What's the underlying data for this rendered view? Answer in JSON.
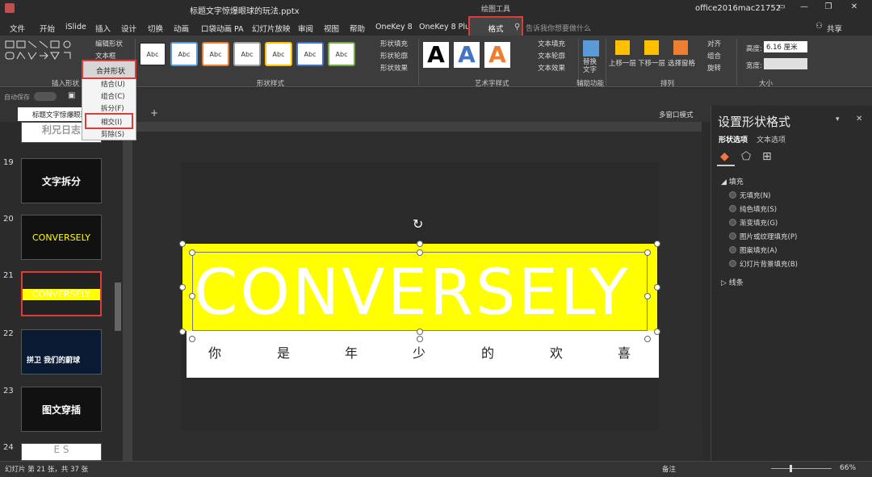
{
  "window": {
    "doc_title": "标题文字惊爆眼球的玩法.pptx",
    "user": "office2016mac21752",
    "drawing_tools_label": "绘图工具",
    "min": "—",
    "restore": "❐",
    "close": "✕"
  },
  "menu": {
    "tabs": [
      "文件",
      "开始",
      "iSlide",
      "插入",
      "设计",
      "切换",
      "动画",
      "口袋动画 PA",
      "幻灯片放映",
      "审阅",
      "视图",
      "帮助",
      "OneKey 8",
      "OneKey 8 Plus"
    ],
    "active_tab": "格式",
    "tellme": "告诉我你想要做什么",
    "share": "共享"
  },
  "ribbon": {
    "edit_shape": "编辑形状",
    "textbox": "文本框",
    "merge_shapes": "合并形状",
    "group_insert": "插入形状",
    "style_label": "Abc",
    "group_shape_styles": "形状样式",
    "shape_fill": "形状填充",
    "shape_outline": "形状轮廓",
    "shape_effect": "形状效果",
    "art_letter": "A",
    "text_fill": "文本填充",
    "text_outline": "文本轮廓",
    "text_effect": "文本效果",
    "group_art": "艺术字样式",
    "alt_text": "替换文字",
    "group_assist": "辅助功能",
    "bring_forward": "上移一层",
    "send_backward": "下移一层",
    "selection_pane": "选择窗格",
    "align": "对齐",
    "group": "组合",
    "rotate": "旋转",
    "group_arrange": "排列",
    "height_label": "高度:",
    "height_value": "6.16 厘米",
    "width_label": "宽度:",
    "group_size": "大小"
  },
  "quickbar": {
    "autosave": "自动保存"
  },
  "doctab": {
    "name": "标题文字惊爆眼球的玩法",
    "multiwin": "多窗口模式"
  },
  "dropdown": {
    "items": [
      "结合(U)",
      "组合(C)",
      "拆分(F)",
      "相交(I)",
      "剪除(S)"
    ]
  },
  "thumbnails": [
    {
      "num": "",
      "label": "利兄日志"
    },
    {
      "num": "19",
      "label": "文字拆分",
      "sub": "05"
    },
    {
      "num": "20",
      "label": "CONVERSELY"
    },
    {
      "num": "21",
      "label": "CONVERSELY"
    },
    {
      "num": "22",
      "label": "拼卫 我们的蔚球"
    },
    {
      "num": "23",
      "label": "图文穿插",
      "sub": "06"
    },
    {
      "num": "24",
      "label": "E S"
    }
  ],
  "slide": {
    "big_text": "CONVERSELY",
    "sub_chars": [
      "你",
      "是",
      "年",
      "少",
      "的",
      "欢",
      "喜"
    ],
    "colors": {
      "yellow": "#ffff00",
      "white": "#ffffff"
    }
  },
  "format_pane": {
    "title": "设置形状格式",
    "tab_shape": "形状选项",
    "tab_text": "文本选项",
    "fill_header": "填充",
    "fill_options": [
      "无填充(N)",
      "纯色填充(S)",
      "渐变填充(G)",
      "图片或纹理填充(P)",
      "图案填充(A)",
      "幻灯片背景填充(B)"
    ],
    "line_header": "线条"
  },
  "status": {
    "slide_info": "幻灯片 第 21 张，共 37 张",
    "notes": "备注",
    "zoom": "66%"
  }
}
